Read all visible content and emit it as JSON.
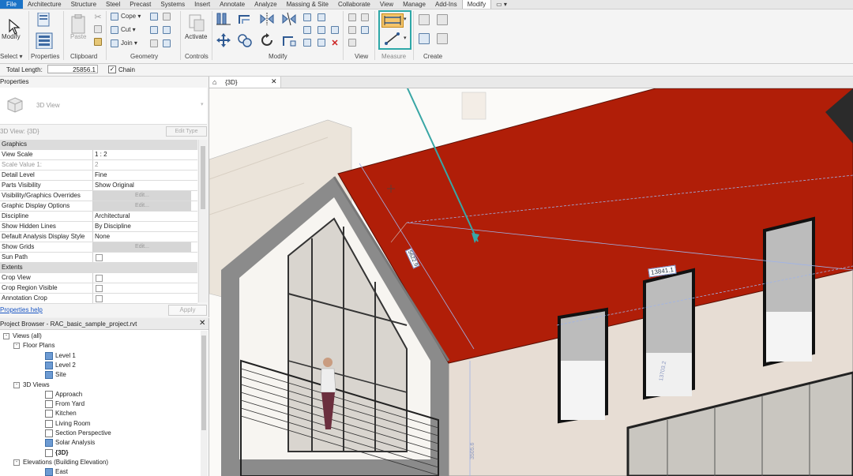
{
  "menubar": {
    "tabs": [
      "File",
      "Architecture",
      "Structure",
      "Steel",
      "Precast",
      "Systems",
      "Insert",
      "Annotate",
      "Analyze",
      "Massing & Site",
      "Collaborate",
      "View",
      "Manage",
      "Add-Ins",
      "Modify"
    ],
    "active_tab": "Modify"
  },
  "ribbon": {
    "modify_label": "Modify",
    "paste_label": "Paste",
    "cope_label": "Cope",
    "cut_label": "Cut",
    "join_label": "Join",
    "activate_label": "Activate",
    "panels": {
      "select": "Select",
      "properties": "Properties",
      "clipboard": "Clipboard",
      "geometry": "Geometry",
      "controls": "Controls",
      "modify": "Modify",
      "view": "View",
      "measure": "Measure",
      "create": "Create"
    },
    "highlight_color": "#2ea8a8"
  },
  "options_bar": {
    "total_length_label": "Total Length:",
    "total_length_value": "25856.1",
    "chain_label": "Chain"
  },
  "properties": {
    "title": "Properties",
    "type_name": "3D View",
    "instance_label": "3D View: {3D}",
    "edit_type": "Edit Type",
    "rows": [
      {
        "kind": "section",
        "k": "Graphics"
      },
      {
        "k": "View Scale",
        "v": "1 : 2"
      },
      {
        "k": "Scale Value    1:",
        "v": "2",
        "dim": true
      },
      {
        "k": "Detail Level",
        "v": "Fine"
      },
      {
        "k": "Parts Visibility",
        "v": "Show Original"
      },
      {
        "k": "Visibility/Graphics Overrides",
        "btn": "Edit..."
      },
      {
        "k": "Graphic Display Options",
        "btn": "Edit..."
      },
      {
        "k": "Discipline",
        "v": "Architectural"
      },
      {
        "k": "Show Hidden Lines",
        "v": "By Discipline"
      },
      {
        "k": "Default Analysis Display Style",
        "v": "None"
      },
      {
        "k": "Show Grids",
        "btn": "Edit...",
        "shade": true
      },
      {
        "k": "Sun Path",
        "cb": true
      },
      {
        "kind": "section",
        "k": "Extents"
      },
      {
        "k": "Crop View",
        "cb": true
      },
      {
        "k": "Crop Region Visible",
        "cb": true
      },
      {
        "k": "Annotation Crop",
        "cb": true
      }
    ],
    "help": "Properties help",
    "apply": "Apply"
  },
  "browser": {
    "title": "Project Browser - RAC_basic_sample_project.rvt",
    "nodes": [
      {
        "label": "Views (all)",
        "level": 0,
        "exp": "-"
      },
      {
        "label": "Floor Plans",
        "level": 1,
        "exp": "-"
      },
      {
        "label": "Level 1",
        "level": 2,
        "icon": "blue"
      },
      {
        "label": "Level 2",
        "level": 2,
        "icon": "blue"
      },
      {
        "label": "Site",
        "level": 2,
        "icon": "blue"
      },
      {
        "label": "3D Views",
        "level": 1,
        "exp": "-"
      },
      {
        "label": "Approach",
        "level": 2,
        "icon": "white"
      },
      {
        "label": "From Yard",
        "level": 2,
        "icon": "white"
      },
      {
        "label": "Kitchen",
        "level": 2,
        "icon": "white"
      },
      {
        "label": "Living Room",
        "level": 2,
        "icon": "white"
      },
      {
        "label": "Section Perspective",
        "level": 2,
        "icon": "white"
      },
      {
        "label": "Solar Analysis",
        "level": 2,
        "icon": "blue"
      },
      {
        "label": "{3D}",
        "level": 2,
        "icon": "white",
        "bold": true
      },
      {
        "label": "Elevations (Building Elevation)",
        "level": 1,
        "exp": "-"
      },
      {
        "label": "East",
        "level": 2,
        "icon": "blue"
      }
    ]
  },
  "view_tab": {
    "label": "{3D}"
  },
  "viewport": {
    "dim_slope": "5622.9",
    "dim_ridge": "13841.1",
    "dim_window": "13703.2",
    "dim_wall": "3505.6",
    "roof_color": "#b01e08"
  }
}
